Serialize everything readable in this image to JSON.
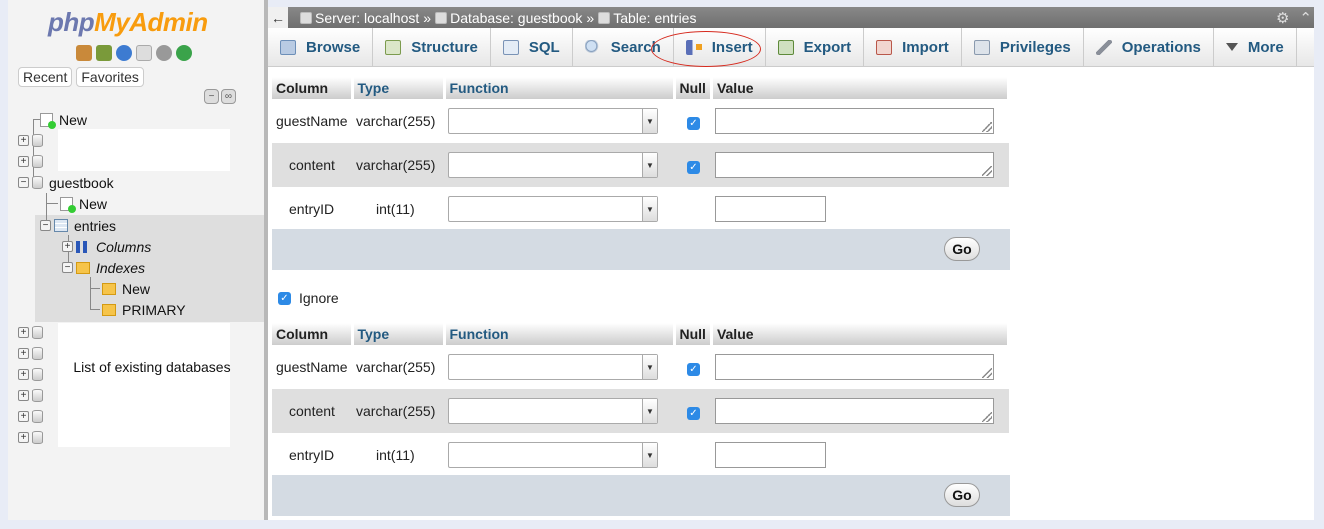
{
  "nav": {
    "logo_php": "php",
    "logo_myadmin": "MyAdmin",
    "tab_recent": "Recent",
    "tab_favorites": "Favorites",
    "tree": {
      "new_label": "New",
      "db_name": "guestbook",
      "db_new_label": "New",
      "table_name": "entries",
      "columns_label": "Columns",
      "indexes_label": "Indexes",
      "index_new_label": "New",
      "index_primary_label": "PRIMARY"
    },
    "db_list_caption": "List of existing databases"
  },
  "topbar": {
    "back": "←",
    "server": "Server: localhost",
    "database": "Database: guestbook",
    "table": "Table: entries",
    "sep": "»",
    "settings_icon": "⚙",
    "collapse_icon": "⌃"
  },
  "tabs": [
    {
      "label": "Browse",
      "icon": "browse-icon"
    },
    {
      "label": "Structure",
      "icon": "structure-icon"
    },
    {
      "label": "SQL",
      "icon": "sql-icon"
    },
    {
      "label": "Search",
      "icon": "search-icon"
    },
    {
      "label": "Insert",
      "icon": "insert-icon"
    },
    {
      "label": "Export",
      "icon": "export-icon"
    },
    {
      "label": "Import",
      "icon": "import-icon"
    },
    {
      "label": "Privileges",
      "icon": "privileges-icon"
    },
    {
      "label": "Operations",
      "icon": "operations-icon"
    },
    {
      "label": "More",
      "icon": "more-icon"
    }
  ],
  "headers": {
    "column": "Column",
    "type": "Type",
    "function": "Function",
    "null": "Null",
    "value": "Value"
  },
  "form1": {
    "rows": [
      {
        "column": "guestName",
        "type": "varchar(255)",
        "null_checked": true
      },
      {
        "column": "content",
        "type": "varchar(255)",
        "null_checked": true
      },
      {
        "column": "entryID",
        "type": "int(11)",
        "null_checked": false
      }
    ],
    "go": "Go"
  },
  "ignore_label": "Ignore",
  "form2": {
    "rows": [
      {
        "column": "guestName",
        "type": "varchar(255)",
        "null_checked": true
      },
      {
        "column": "content",
        "type": "varchar(255)",
        "null_checked": true
      },
      {
        "column": "entryID",
        "type": "int(11)",
        "null_checked": false
      }
    ],
    "go": "Go"
  },
  "colors": {
    "tab_text": "#235a81",
    "annotation": "#d62b1f",
    "checkbox": "#2d8ae6"
  }
}
